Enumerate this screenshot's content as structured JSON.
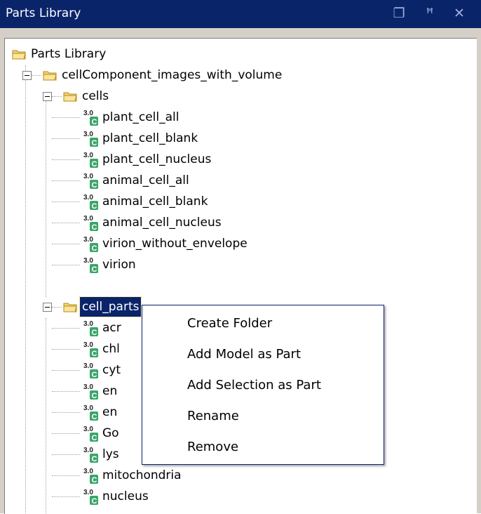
{
  "window": {
    "title": "Parts Library"
  },
  "titlebar_buttons": [
    {
      "icon": "restore-icon",
      "glyph": "❐"
    },
    {
      "icon": "pin-icon",
      "glyph": "ꟸ"
    },
    {
      "icon": "close-icon",
      "glyph": "✕"
    }
  ],
  "tree": {
    "root": "Parts Library",
    "collection": "cellComponent_images_with_volume",
    "cells_folder": "cells",
    "cells": [
      "plant_cell_all",
      "plant_cell_blank",
      "plant_cell_nucleus",
      "animal_cell_all",
      "animal_cell_blank",
      "animal_cell_nucleus",
      "virion_without_envelope",
      "virion"
    ],
    "parts_folder": "cell_parts",
    "parts": [
      "acr",
      "chl",
      "cyt",
      "en",
      "en",
      "Go",
      "lys",
      "mitochondria",
      "nucleus"
    ],
    "part_badge": "3.0",
    "part_badge_letter": "C"
  },
  "context_menu": {
    "items": [
      "Create Folder",
      "Add Model as Part",
      "Add Selection as Part",
      "Rename",
      "Remove"
    ]
  },
  "colors": {
    "titlebar": "#0a246a",
    "selection": "#0a246a",
    "folder": "#f6d36a",
    "part_badge": "#3aa66a"
  }
}
